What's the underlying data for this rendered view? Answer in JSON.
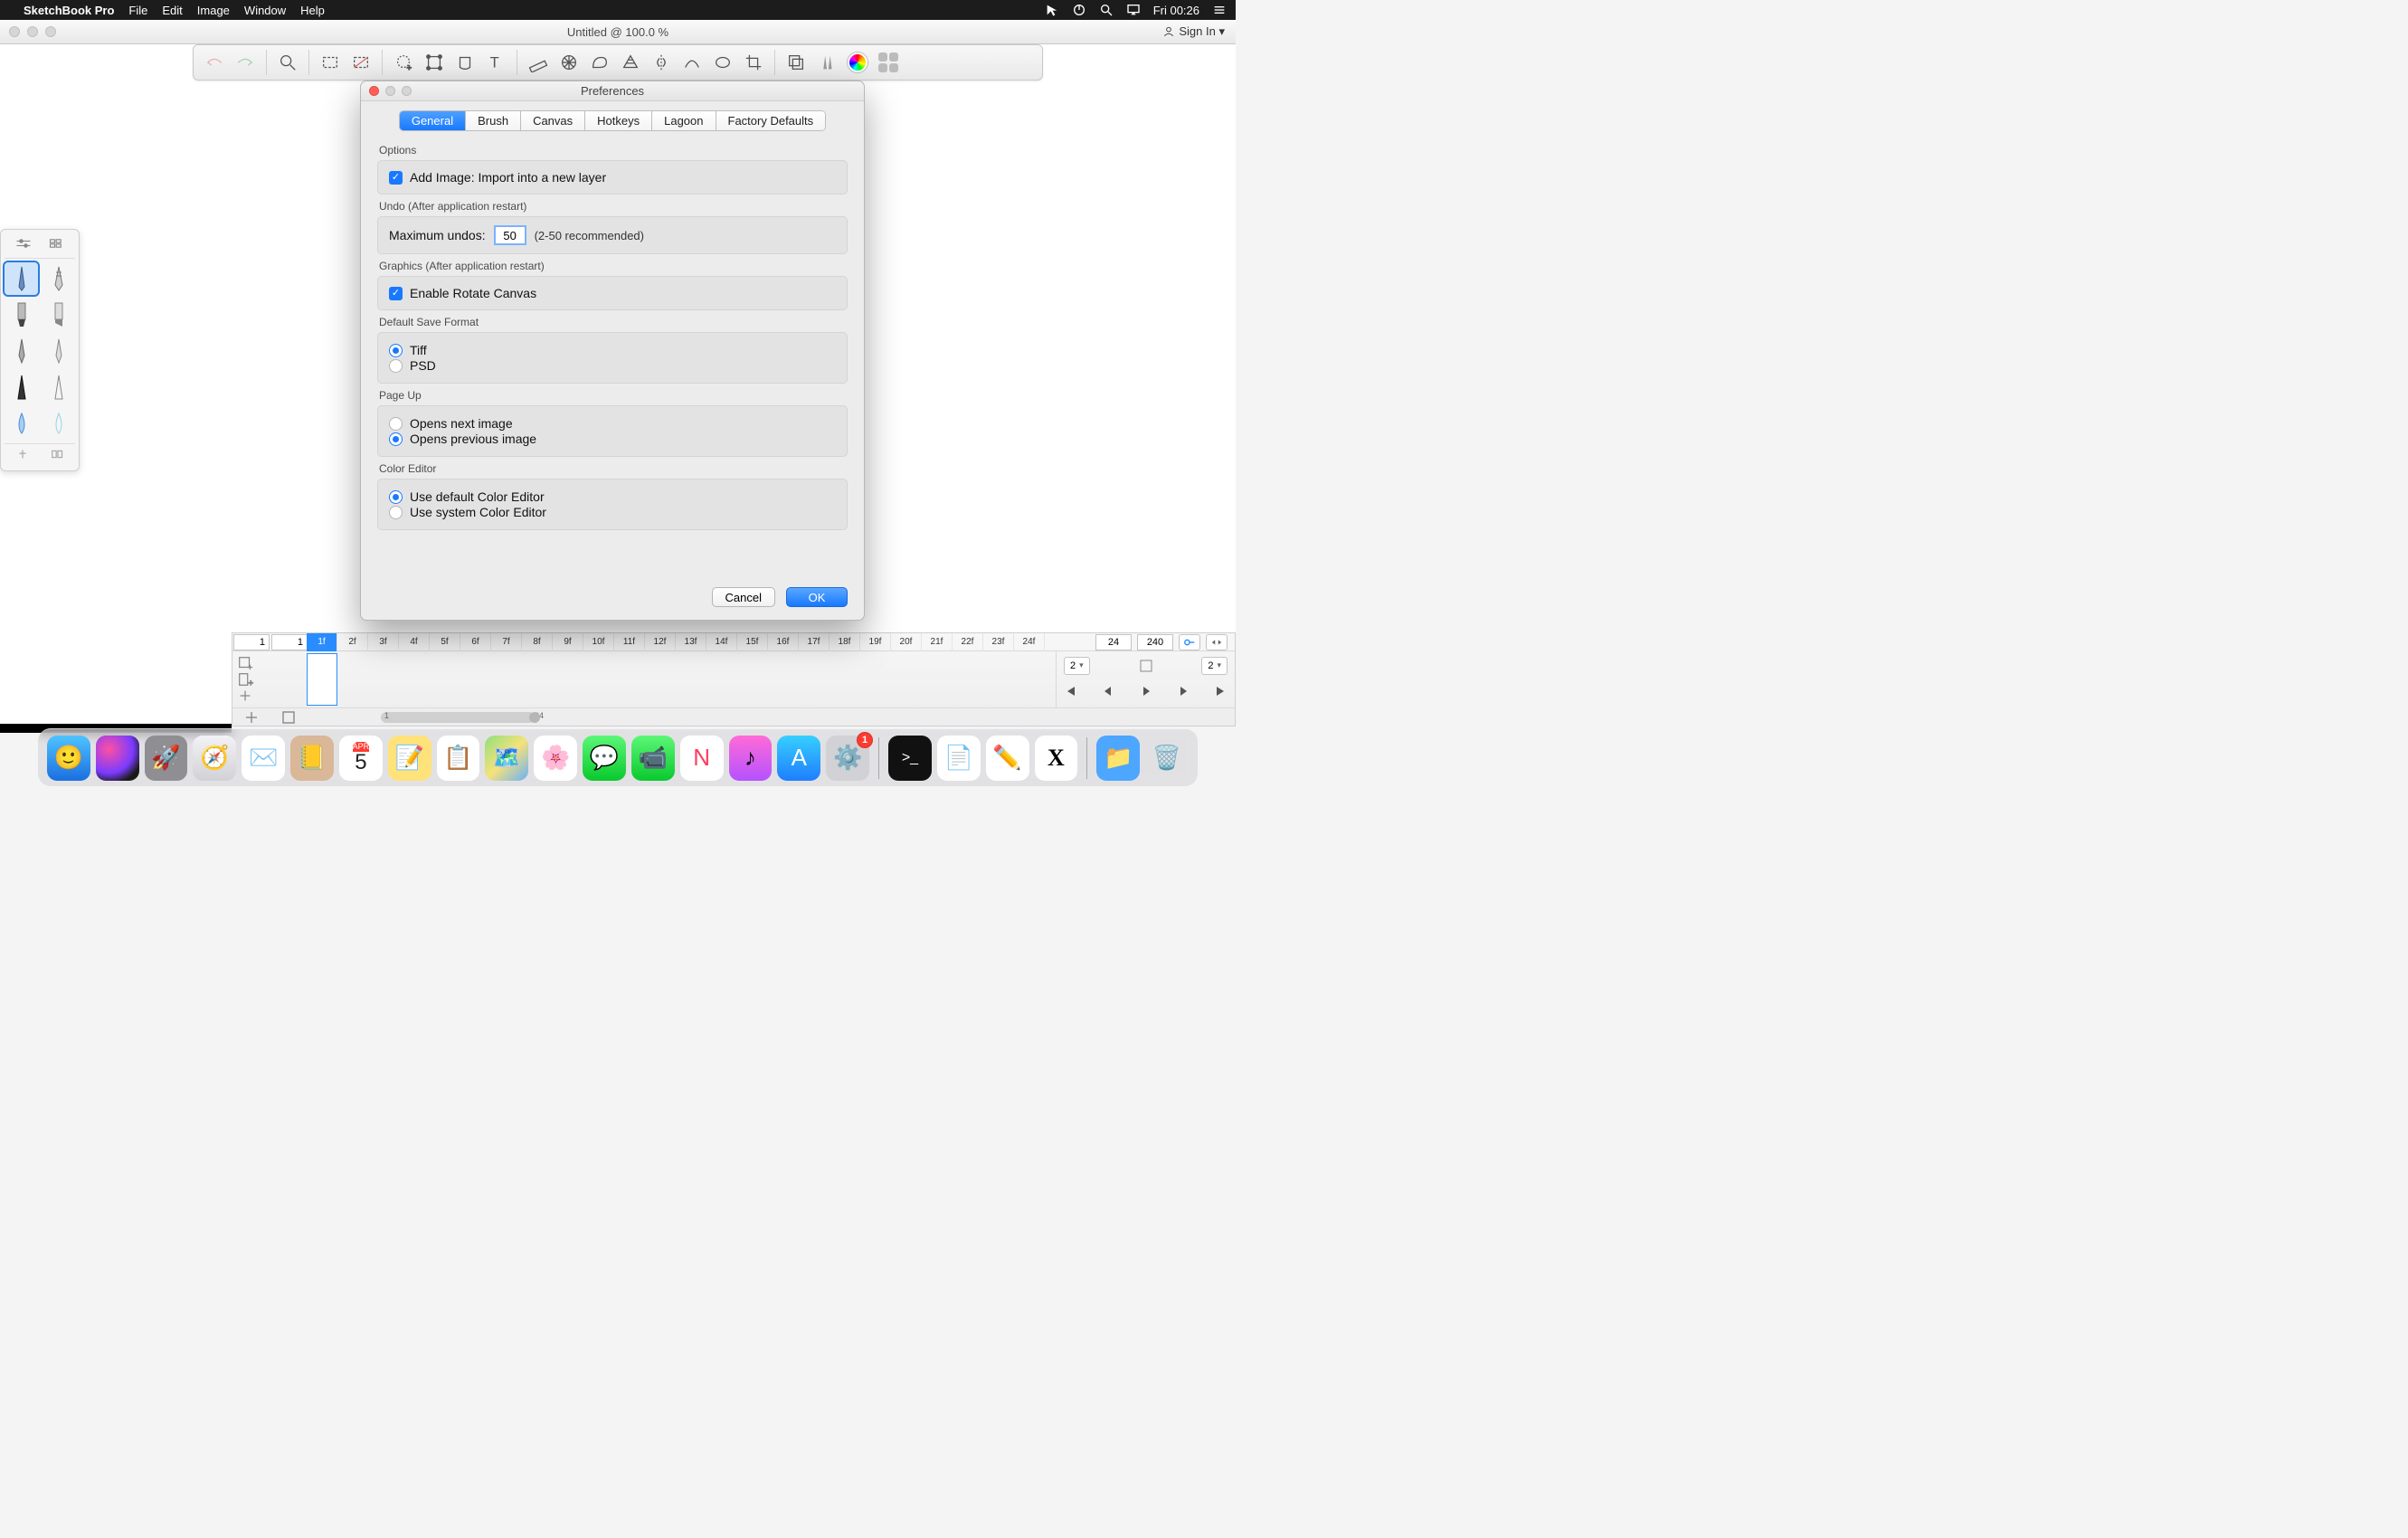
{
  "menubar": {
    "app": "SketchBook Pro",
    "items": [
      "File",
      "Edit",
      "Image",
      "Window",
      "Help"
    ],
    "clock": "Fri 00:26"
  },
  "document": {
    "title": "Untitled @ 100.0 %",
    "signin": "Sign In ▾"
  },
  "toolbar_icons": [
    "undo",
    "redo",
    "zoom",
    "select-rect",
    "select-rect-dash",
    "lasso-add",
    "transform",
    "fill-bucket",
    "text",
    "ruler",
    "symmetry-radial",
    "french-curve",
    "perspective",
    "flip-h",
    "curve",
    "ellipse",
    "crop",
    "layers",
    "brush-pair",
    "color",
    "ui-grid"
  ],
  "brushes": {
    "rows": [
      [
        "pencil",
        "tech-pen"
      ],
      [
        "marker",
        "chisel"
      ],
      [
        "pen",
        "nib"
      ],
      [
        "cone",
        "fill-cone"
      ],
      [
        "drop",
        "drop-outline"
      ]
    ],
    "selected": "pencil"
  },
  "prefs": {
    "title": "Preferences",
    "tabs": [
      "General",
      "Brush",
      "Canvas",
      "Hotkeys",
      "Lagoon",
      "Factory Defaults"
    ],
    "active_tab": "General",
    "options": {
      "label": "Options",
      "add_image": {
        "checked": true,
        "text": "Add Image: Import into a new layer"
      }
    },
    "undo": {
      "label": "Undo (After application restart)",
      "max_label": "Maximum undos:",
      "value": "50",
      "hint": "(2-50 recommended)"
    },
    "graphics": {
      "label": "Graphics (After application restart)",
      "rotate": {
        "checked": true,
        "text": "Enable Rotate Canvas"
      }
    },
    "saveformat": {
      "label": "Default Save Format",
      "options": [
        {
          "text": "Tiff",
          "selected": true
        },
        {
          "text": "PSD",
          "selected": false
        }
      ]
    },
    "pageup": {
      "label": "Page Up",
      "options": [
        {
          "text": "Opens next image",
          "selected": false
        },
        {
          "text": "Opens previous image",
          "selected": true
        }
      ]
    },
    "coloreditor": {
      "label": "Color Editor",
      "options": [
        {
          "text": "Use default Color Editor",
          "selected": true
        },
        {
          "text": "Use system Color Editor",
          "selected": false
        }
      ]
    },
    "buttons": {
      "cancel": "Cancel",
      "ok": "OK"
    }
  },
  "timeline": {
    "start": "1",
    "current": "1",
    "frames": [
      "1f",
      "2f",
      "3f",
      "4f",
      "5f",
      "6f",
      "7f",
      "8f",
      "9f",
      "10f",
      "11f",
      "12f",
      "13f",
      "14f",
      "15f",
      "16f",
      "17f",
      "18f",
      "19f",
      "20f",
      "21f",
      "22f",
      "23f",
      "24f"
    ],
    "selected_frame": "1f",
    "range_a": "24",
    "range_b": "240",
    "drop_a": "2",
    "drop_b": "2",
    "scrub_a": "1",
    "scrub_b": "24"
  },
  "dock": {
    "apps": [
      "finder",
      "siri",
      "launch",
      "safari",
      "mail",
      "contacts",
      "cal",
      "notes",
      "rem",
      "maps",
      "photos",
      "msg",
      "ft",
      "news",
      "itunes",
      "store",
      "sys"
    ],
    "right": [
      "term",
      "te",
      "skb",
      "xq"
    ],
    "far": [
      "dl",
      "trash"
    ],
    "badges": {
      "sys": "1"
    },
    "calendar": {
      "month": "APR",
      "day": "5"
    }
  }
}
